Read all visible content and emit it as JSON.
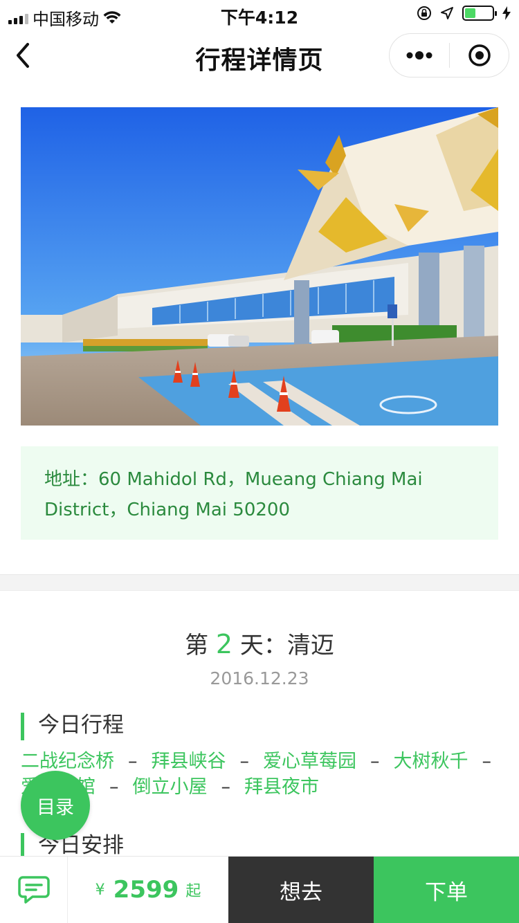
{
  "status_bar": {
    "carrier": "中国移动",
    "time": "下午4:12",
    "icons": [
      "signal-icon",
      "wifi-icon",
      "orientation-lock-icon",
      "location-icon",
      "battery-icon",
      "charging-icon"
    ],
    "battery_level": 0.4
  },
  "nav": {
    "title": "行程详情页",
    "back_icon": "chevron-left-icon",
    "more_icon": "more-dots-icon",
    "close_icon": "target-close-icon"
  },
  "address": {
    "label": "地址：",
    "text": "60 Mahidol Rd，Mueang Chiang Mai District，Chiang Mai 50200"
  },
  "day": {
    "prefix": "第",
    "number": "2",
    "suffix": "天：清迈",
    "date": "2016.12.23"
  },
  "sections": {
    "today_route": "今日行程",
    "today_plan": "今日安排"
  },
  "route": {
    "stops": [
      "二战纪念桥",
      "拜县峡谷",
      "爱心草莓园",
      "大树秋千",
      "爱咖啡馆",
      "倒立小屋",
      "拜县夜市"
    ],
    "separator": "–"
  },
  "catalog_button": "目录",
  "bottom_bar": {
    "chat_icon": "chat-bubble-icon",
    "currency": "¥",
    "price": "2599",
    "price_suffix": "起",
    "want_label": "想去",
    "order_label": "下单"
  },
  "colors": {
    "accent": "#3cc55e",
    "address_bg": "#eefcf1",
    "address_text": "#2b8a3e",
    "dark_button": "#333333"
  }
}
